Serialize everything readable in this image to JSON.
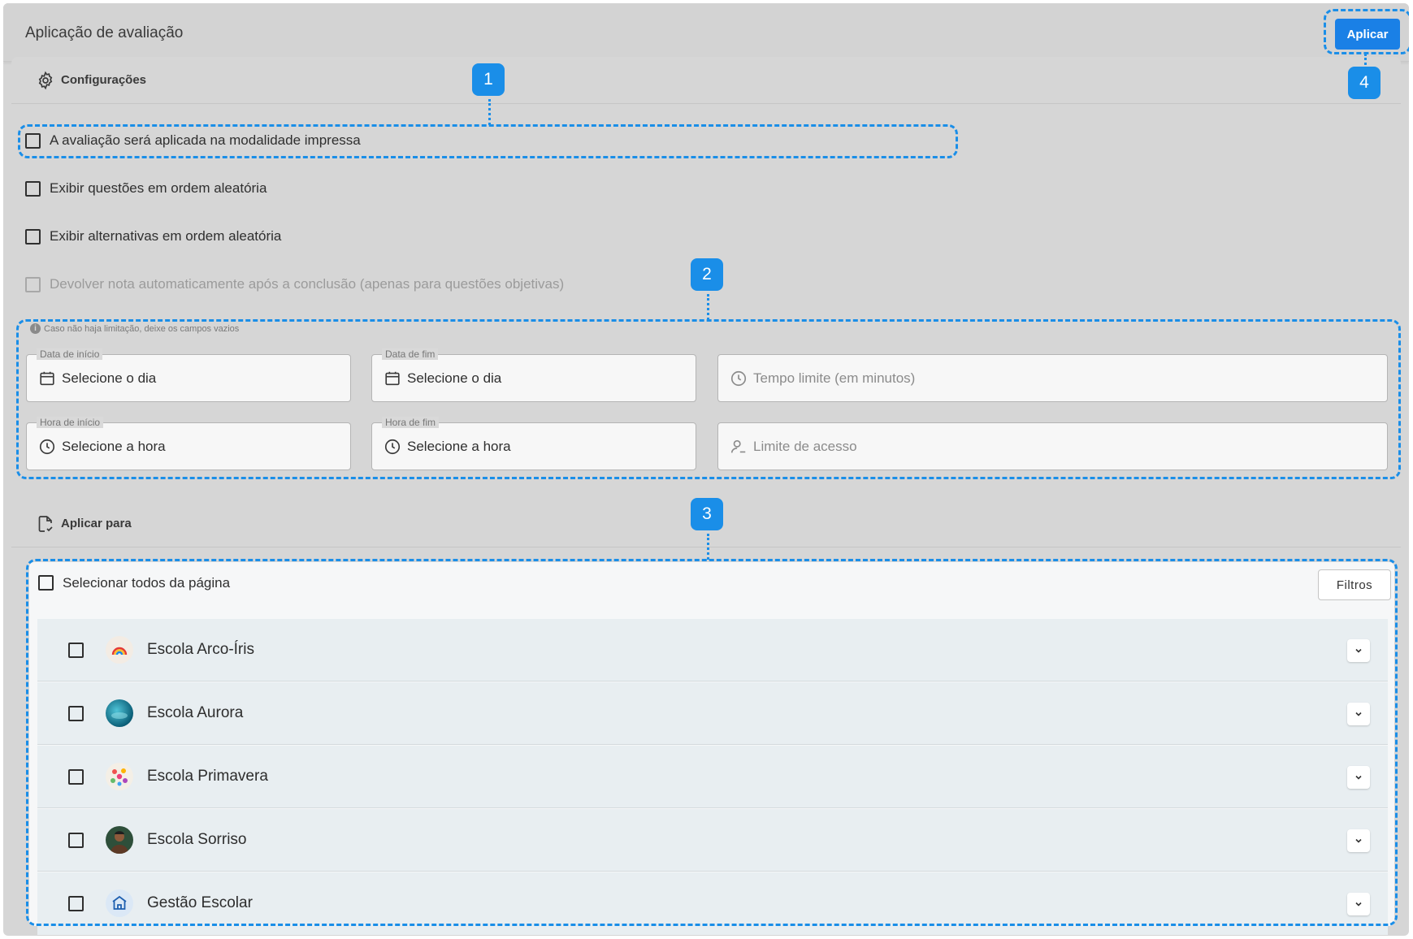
{
  "header": {
    "title": "Aplicação de avaliação",
    "apply_label": "Aplicar"
  },
  "config": {
    "title": "Configurações",
    "icon": "gear-icon",
    "options": [
      {
        "label": "A avaliação será aplicada na modalidade impressa",
        "checked": false,
        "disabled": false
      },
      {
        "label": "Exibir questões em ordem aleatória",
        "checked": false,
        "disabled": false
      },
      {
        "label": "Exibir alternativas em ordem aleatória",
        "checked": false,
        "disabled": false
      },
      {
        "label": "Devolver nota automaticamente após a conclusão (apenas para questões objetivas)",
        "checked": false,
        "disabled": true
      }
    ],
    "hint": "Caso não haja limitação, deixe os campos vazios",
    "fields": {
      "start_date": {
        "legend": "Data de início",
        "value": "Selecione o dia",
        "icon": "calendar-icon"
      },
      "end_date": {
        "legend": "Data de fim",
        "value": "Selecione o dia",
        "icon": "calendar-icon"
      },
      "time_limit": {
        "placeholder": "Tempo limite (em minutos)",
        "icon": "clock-icon"
      },
      "start_time": {
        "legend": "Hora de início",
        "value": "Selecione a hora",
        "icon": "clock-icon"
      },
      "end_time": {
        "legend": "Hora de fim",
        "value": "Selecione a hora",
        "icon": "clock-icon"
      },
      "access_limit": {
        "placeholder": "Limite de acesso",
        "icon": "user-limit-icon"
      }
    }
  },
  "apply_to": {
    "title": "Aplicar para",
    "icon": "document-check-icon",
    "select_all_label": "Selecionar todos da página",
    "filters_label": "Filtros",
    "schools": [
      {
        "name": "Escola Arco-Íris",
        "avatar": "rainbow-avatar"
      },
      {
        "name": "Escola Aurora",
        "avatar": "globe-avatar"
      },
      {
        "name": "Escola Primavera",
        "avatar": "flowers-avatar"
      },
      {
        "name": "Escola Sorriso",
        "avatar": "person-avatar"
      },
      {
        "name": "Gestão Escolar",
        "avatar": "school-building-avatar"
      }
    ]
  },
  "annotations": {
    "badges": [
      "1",
      "2",
      "3",
      "4"
    ]
  },
  "colors": {
    "accent": "#1a80e6",
    "annotation": "#1a8ee8",
    "background": "#d6d6d6",
    "row": "#e8eef1"
  }
}
